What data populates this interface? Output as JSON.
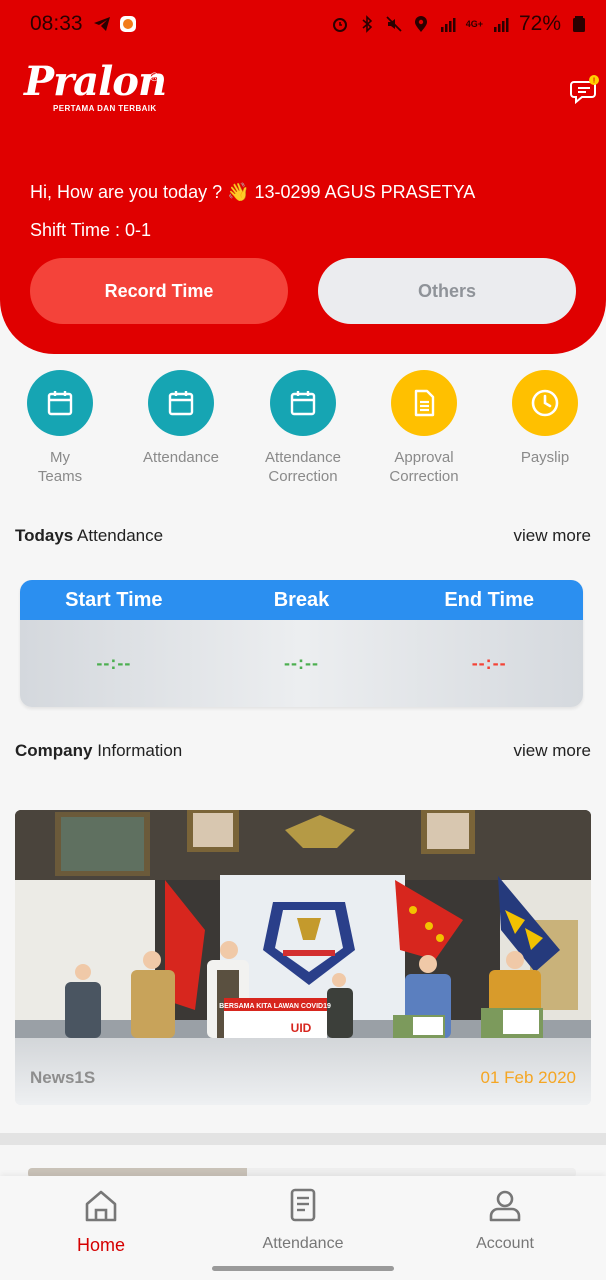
{
  "status_bar": {
    "time": "08:33",
    "battery": "72%",
    "network": "4G+"
  },
  "header": {
    "logo_text": "Pralon",
    "logo_tagline": "PERTAMA DAN TERBAIK",
    "greeting": "Hi, How are you today ? 👋 13-0299 AGUS PRASETYA",
    "shift": "Shift Time : 0-1",
    "record_button": "Record Time",
    "others_button": "Others"
  },
  "menu": [
    {
      "label_line1": "My",
      "label_line2": "Teams",
      "icon": "calendar-icon",
      "color": "#16a5b3"
    },
    {
      "label_line1": "Attendance",
      "label_line2": "",
      "icon": "calendar-icon",
      "color": "#16a5b3"
    },
    {
      "label_line1": "Attendance",
      "label_line2": "Correction",
      "icon": "calendar-icon",
      "color": "#16a5b3"
    },
    {
      "label_line1": "Approval",
      "label_line2": "Correction",
      "icon": "document-icon",
      "color": "#ffc000"
    },
    {
      "label_line1": "Payslip",
      "label_line2": "",
      "icon": "clock-icon",
      "color": "#ffc000"
    }
  ],
  "todays_attendance": {
    "title_bold": "Todays",
    "title_rest": " Attendance",
    "view_more": "view more",
    "columns": [
      "Start Time",
      "Break",
      "End Time"
    ],
    "values": [
      "--:--",
      "--:--",
      "--:--"
    ],
    "header_color": "#2b8ff0"
  },
  "company_info": {
    "title_bold": "Company",
    "title_rest": " Information",
    "view_more": "view more",
    "news": {
      "banner_text": "BERSAMA KITA LAWAN COVID19",
      "banner_sub": "UID",
      "source": "News1S",
      "date": "01 Feb 2020"
    }
  },
  "bottom_nav": [
    {
      "label": "Home",
      "icon": "home-icon",
      "active": true
    },
    {
      "label": "Attendance",
      "icon": "attendance-doc-icon",
      "active": false
    },
    {
      "label": "Account",
      "icon": "account-icon",
      "active": false
    }
  ],
  "colors": {
    "brand_red": "#e00000",
    "record_button": "#f4433a",
    "teal": "#16a5b3",
    "yellow": "#ffc000",
    "date_orange": "#f5a623"
  }
}
